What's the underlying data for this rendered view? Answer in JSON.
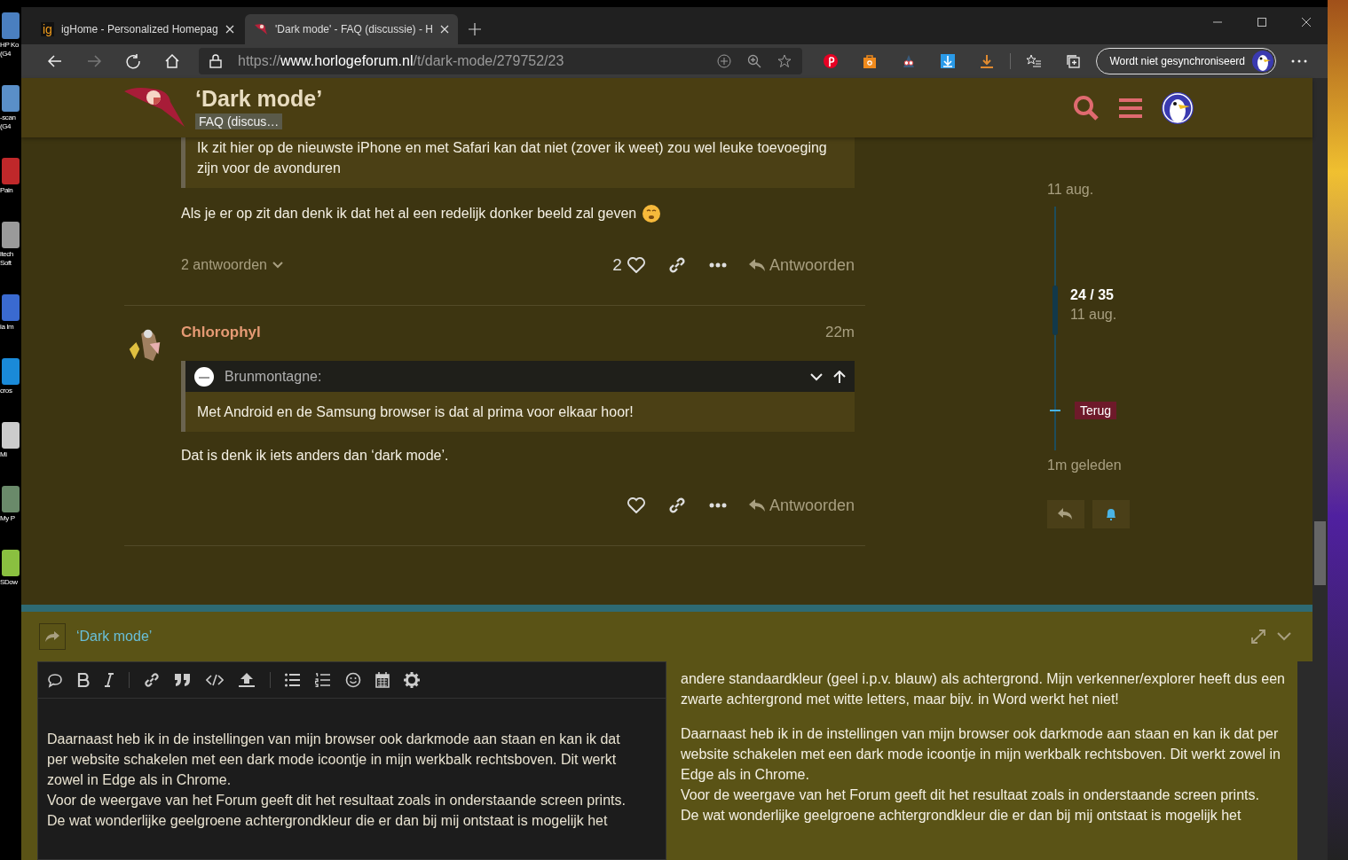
{
  "desktop": {
    "shortcuts": [
      {
        "label": "HP Ko (G4",
        "color": "#4a7fc0"
      },
      {
        "label": "-scan (G4",
        "color": "#5a8fc8"
      },
      {
        "label": "Pain",
        "color": "#c0282a"
      },
      {
        "label": "itech Soft",
        "color": "#9a9a9a"
      },
      {
        "label": "ia Im",
        "color": "#3a6ad0"
      },
      {
        "label": "cros",
        "color": "#1a8ad8"
      },
      {
        "label": "Mi",
        "color": "#cccccc"
      },
      {
        "label": "My P",
        "color": "#6a8a6a"
      },
      {
        "label": "SDow",
        "color": "#8ac040"
      }
    ]
  },
  "browser": {
    "tabs": [
      {
        "favicon": "ig",
        "title": "igHome - Personalized Homepag",
        "selected": false
      },
      {
        "title": "'Dark mode' - FAQ (discussie) - H",
        "selected": true
      }
    ],
    "address": {
      "scheme": "https://",
      "host": "www.horlogeforum.nl",
      "path": "/t/dark-mode/279752/23"
    },
    "sync_button": "Wordt niet gesynchroniseerd"
  },
  "header": {
    "title": "‘Dark mode’",
    "category": "FAQ (discus…"
  },
  "posts": [
    {
      "quote": {
        "text": "Ik zit hier op de nieuwste iPhone en met Safari kan dat niet (zover ik weet) zou wel leuke toevoeging zijn voor de avonduren"
      },
      "text": "Als je er op zit dan denk ik dat het al een redelijk donker beeld zal geven",
      "emoji": true,
      "replies": "2 antwoorden",
      "likes": "2",
      "reply_button": "Antwoorden"
    },
    {
      "author": "Chlorophyl",
      "time": "22m",
      "quote": {
        "author": "Brunmontagne:",
        "text": "Met Android en de Samsung browser is dat al prima voor elkaar hoor!"
      },
      "text": "Dat is denk ik iets anders dan ‘dark mode’.",
      "emoji": false,
      "reply_button": "Antwoorden"
    }
  ],
  "timeline": {
    "start": "11 aug.",
    "position": "24 / 35",
    "position_date": "11 aug.",
    "back": "Terug",
    "end": "1m geleden",
    "level": 0.55
  },
  "composer": {
    "topic": "‘Dark mode’",
    "editor": [
      "Daarnaast heb ik in de instellingen van mijn browser ook darkmode aan staan en kan ik dat per website schakelen met een dark mode icoontje in mijn werkbalk rechtsboven. Dit werkt zowel in Edge als in Chrome.",
      "Voor de weergave van het Forum geeft dit het resultaat zoals in onderstaande screen prints.",
      "De wat wonderlijke geelgroene achtergrondkleur die er dan bij mij ontstaat is mogelijk het"
    ],
    "preview": [
      [
        "andere standaardkleur (geel i.p.v. blauw) als achtergrond. Mijn verkenner/explorer heeft dus een zwarte achtergrond met witte letters, maar bijv. in Word werkt het niet!"
      ],
      [
        "Daarnaast heb ik in de instellingen van mijn browser ook darkmode aan staan en kan ik dat per website schakelen met een dark mode icoontje in mijn werkbalk rechtsboven. Dit werkt zowel in Edge als in Chrome.",
        "Voor de weergave van het Forum geeft dit het resultaat zoals in onderstaande screen prints.",
        "De wat wonderlijke geelgroene achtergrondkleur die er dan bij mij ontstaat is mogelijk het"
      ]
    ]
  }
}
